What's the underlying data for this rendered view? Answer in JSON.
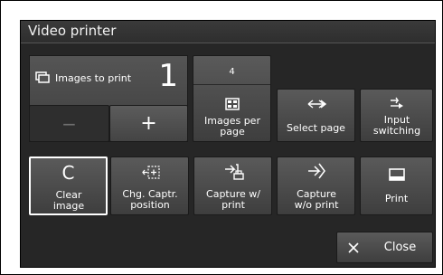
{
  "dialog": {
    "title": "Video printer"
  },
  "images_to_print": {
    "label": "Images to print",
    "count": "1",
    "icon": "images-icon",
    "minus_label": "−",
    "plus_label": "+"
  },
  "images_per_page": {
    "value": "4",
    "label": "Images per page",
    "icon": "grid-icon"
  },
  "select_page": {
    "label": "Select page",
    "icon": "page-arrows-icon"
  },
  "input_switching": {
    "label": "Input switching",
    "icon": "input-switch-icon"
  },
  "clear_image": {
    "letter": "C",
    "label": "Clear image"
  },
  "chg_capture_position": {
    "label": "Chg. Captr. position",
    "icon": "capture-position-icon"
  },
  "capture_with_print": {
    "label": "Capture w/ print",
    "icon": "capture-print-icon"
  },
  "capture_without_print": {
    "label": "Capture w/o print",
    "icon": "capture-icon"
  },
  "print": {
    "label": "Print",
    "icon": "print-icon"
  },
  "close": {
    "label": "Close",
    "icon": "close-icon"
  }
}
